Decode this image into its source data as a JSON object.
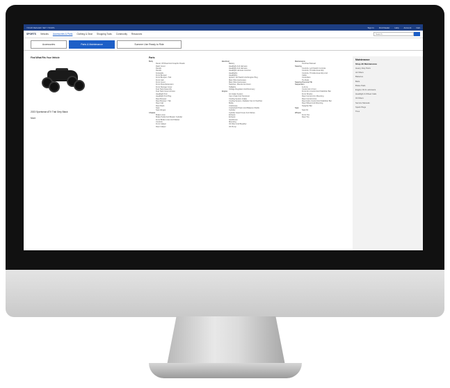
{
  "topbar": {
    "left": "YOUR DEALER: SET YOURS",
    "links": [
      "Sign In",
      "Find Dealer",
      "Help",
      "Account",
      "Cart"
    ]
  },
  "nav": {
    "brand": "SPORTS",
    "items": [
      "Vehicles",
      "Accessories & Parts",
      "Clothing & Gear",
      "Shopping Tools",
      "Community",
      "Resources"
    ],
    "search_placeholder": "Search"
  },
  "tabs": [
    "Accessories",
    "Parts & Maintenance",
    "Summer Use Ready to Ride"
  ],
  "vehicle": {
    "heading": "Find What Fits Your Vehicle",
    "name": "2023 Sportsman ATV Trail Grey Black",
    "link": "More"
  },
  "parts": {
    "heading": "Parts",
    "col1": [
      {
        "t": "Body",
        "h": true
      },
      {
        "t": "Decal, Off Road And Graphic Roads",
        "s": true
      },
      {
        "t": "Dash Cover",
        "s": true
      },
      {
        "t": "Decals",
        "s": true
      },
      {
        "t": "Decals",
        "s": true
      },
      {
        "t": "Footwells",
        "s": true
      },
      {
        "t": "Front Bumper",
        "s": true
      },
      {
        "t": "Front Bumper / Tab",
        "s": true
      },
      {
        "t": "Front Cab",
        "s": true
      },
      {
        "t": "Front Cover",
        "s": true
      },
      {
        "t": "Front Panel Extension",
        "s": true
      },
      {
        "t": "Front Storage Cover",
        "s": true
      },
      {
        "t": "Fuel Tank Assembly",
        "s": true
      },
      {
        "t": "Fuel Tank Cover Access",
        "s": true
      },
      {
        "t": "Headlight Pod",
        "s": true
      },
      {
        "t": "Headlight Pod Plug",
        "s": true
      },
      {
        "t": "Rear Bumper",
        "s": true
      },
      {
        "t": "Rear Bumper / Tab",
        "s": true
      },
      {
        "t": "Rear Cab",
        "s": true
      },
      {
        "t": "Rear Rack",
        "s": true
      },
      {
        "t": "Seat",
        "s": true
      },
      {
        "t": "Seat Hinges",
        "s": true
      },
      {
        "t": "Chassis",
        "h": true
      },
      {
        "t": "Brake Lines",
        "s": true
      },
      {
        "t": "Brake Pedal And Master Cylinder",
        "s": true
      },
      {
        "t": "Front Brake Lines And Master",
        "s": true
      },
      {
        "t": "Controls",
        "s": true
      },
      {
        "t": "Front Caliper",
        "s": true
      },
      {
        "t": "Rear Caliper",
        "s": true
      }
    ],
    "col2": [
      {
        "t": "Electrical",
        "h": true
      },
      {
        "t": "Battery",
        "s": true
      },
      {
        "t": "Headlight And Harness",
        "s": true
      },
      {
        "t": "Headlight And Harness",
        "s": true
      },
      {
        "t": "Headlight Harness Junction",
        "s": true
      },
      {
        "t": "Headlights",
        "s": true
      },
      {
        "t": "Headlights",
        "s": true
      },
      {
        "t": "Ignition, Kill Switch And Engine Plug",
        "s": true
      },
      {
        "t": "Main Wire Harnesses",
        "s": true
      },
      {
        "t": "Main Wire Harnesses",
        "s": true
      },
      {
        "t": "Switches, Mounts And Horn",
        "s": true
      },
      {
        "t": "Taillights",
        "s": true
      },
      {
        "t": "Voltage Regulator And Recovery",
        "s": true
      },
      {
        "t": "Engine",
        "h": true
      },
      {
        "t": "Air Intake System",
        "s": true
      },
      {
        "t": "Cam Chain And Tensioner",
        "s": true
      },
      {
        "t": "Cooling System Intake",
        "s": true
      },
      {
        "t": "Cooling System, Radiator Fan & Overflow",
        "s": true
      },
      {
        "t": "Bottle",
        "s": true
      },
      {
        "t": "Crankcase",
        "s": true
      },
      {
        "t": "Crankshaft Piston And Balance Shafts",
        "s": true
      },
      {
        "t": "Cylinder",
        "s": true
      },
      {
        "t": "Cylinder Head Cover And Valves",
        "s": true
      },
      {
        "t": "Exhaust",
        "s": true
      },
      {
        "t": "Exhaust",
        "s": true
      },
      {
        "t": "Gearboxes",
        "s": true
      },
      {
        "t": "Mounting",
        "s": true
      },
      {
        "t": "Oil Filter And Breather",
        "s": true
      },
      {
        "t": "Oil Pump",
        "s": true
      }
    ],
    "col3": [
      {
        "t": "Maintenance",
        "h": true
      },
      {
        "t": "Overhaul Manual",
        "s": true
      },
      {
        "t": "Steering",
        "h": true
      },
      {
        "t": "Controls, Left Switch Controls",
        "s": true
      },
      {
        "t": "Controls, Throttle Assembly",
        "s": true
      },
      {
        "t": "Controls, Throttle Assembly And",
        "s": true
      },
      {
        "t": "Cable",
        "s": true
      },
      {
        "t": "Controllers",
        "s": true
      },
      {
        "t": "Tie Rods",
        "s": true
      },
      {
        "t": "Steering Post And Tilt",
        "h": true
      },
      {
        "t": "Suspension",
        "h": true
      },
      {
        "t": "A-Arms",
        "s": true
      },
      {
        "t": "Control Arm Front",
        "s": true
      },
      {
        "t": "Front Arm Control And Stabilizer Bar",
        "s": true
      },
      {
        "t": "Front Shocks",
        "s": true
      },
      {
        "t": "Rear Control Arm Mounting",
        "s": true
      },
      {
        "t": "Rear Control Arms",
        "s": true
      },
      {
        "t": "Rear Hubs Control And Stabilizer Bar",
        "s": true
      },
      {
        "t": "Rear Wheel And Mounting",
        "s": true
      },
      {
        "t": "Swaybar Bar",
        "s": true
      },
      {
        "t": "Seat",
        "h": true
      },
      {
        "t": "Seat Kit",
        "s": true
      },
      {
        "t": "Wheels",
        "h": true
      },
      {
        "t": "Front Tire",
        "s": true
      },
      {
        "t": "Rear Tire",
        "s": true
      }
    ]
  },
  "sidebar": {
    "heading": "Maintenance",
    "selected": "Shop All Maintenance",
    "items": [
      "Heavy Duty Parts",
      "Air Filters",
      "Batteries",
      "Belts",
      "Brake Pads",
      "Engine Oil & Lubricants",
      "Headlight & Wheel Cails",
      "Oil Filters",
      "Service Manuals",
      "Spark Plugs",
      "Tires"
    ]
  }
}
